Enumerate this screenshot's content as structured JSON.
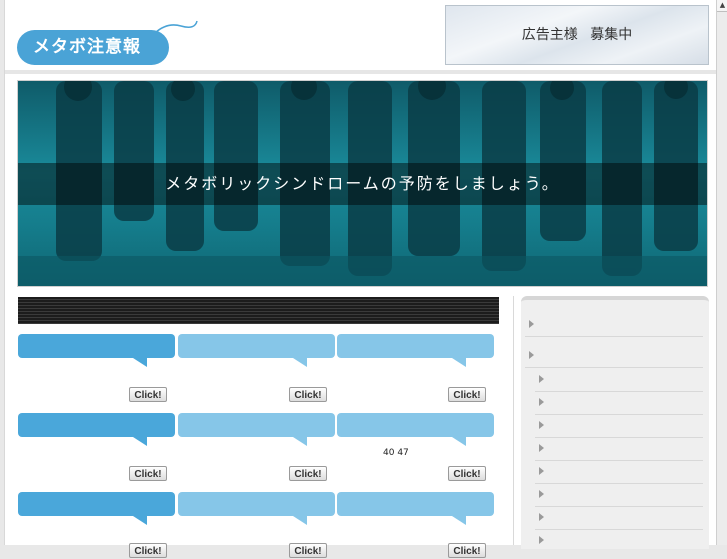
{
  "header": {
    "logo_text": "メタボ注意報",
    "ad_text": "広告主様 募集中"
  },
  "hero": {
    "tagline": "メタボリックシンドロームの予防をしましょう。"
  },
  "main": {
    "click_label": "Click!",
    "number_text": "40 47",
    "bubble_rows": 3,
    "bubbles_per_row": 3
  },
  "sidebar": {
    "top_items": 2,
    "sub_items": 8
  },
  "colors": {
    "accent_dark": "#4aa7da",
    "accent_light": "#86c6e8",
    "hero_teal": "#1a8b9b"
  },
  "icons": {
    "logo_decoration": "string-line-icon",
    "sidebar_bullet": "triangle-arrow-icon",
    "scroll_up": "up-arrow-icon"
  }
}
